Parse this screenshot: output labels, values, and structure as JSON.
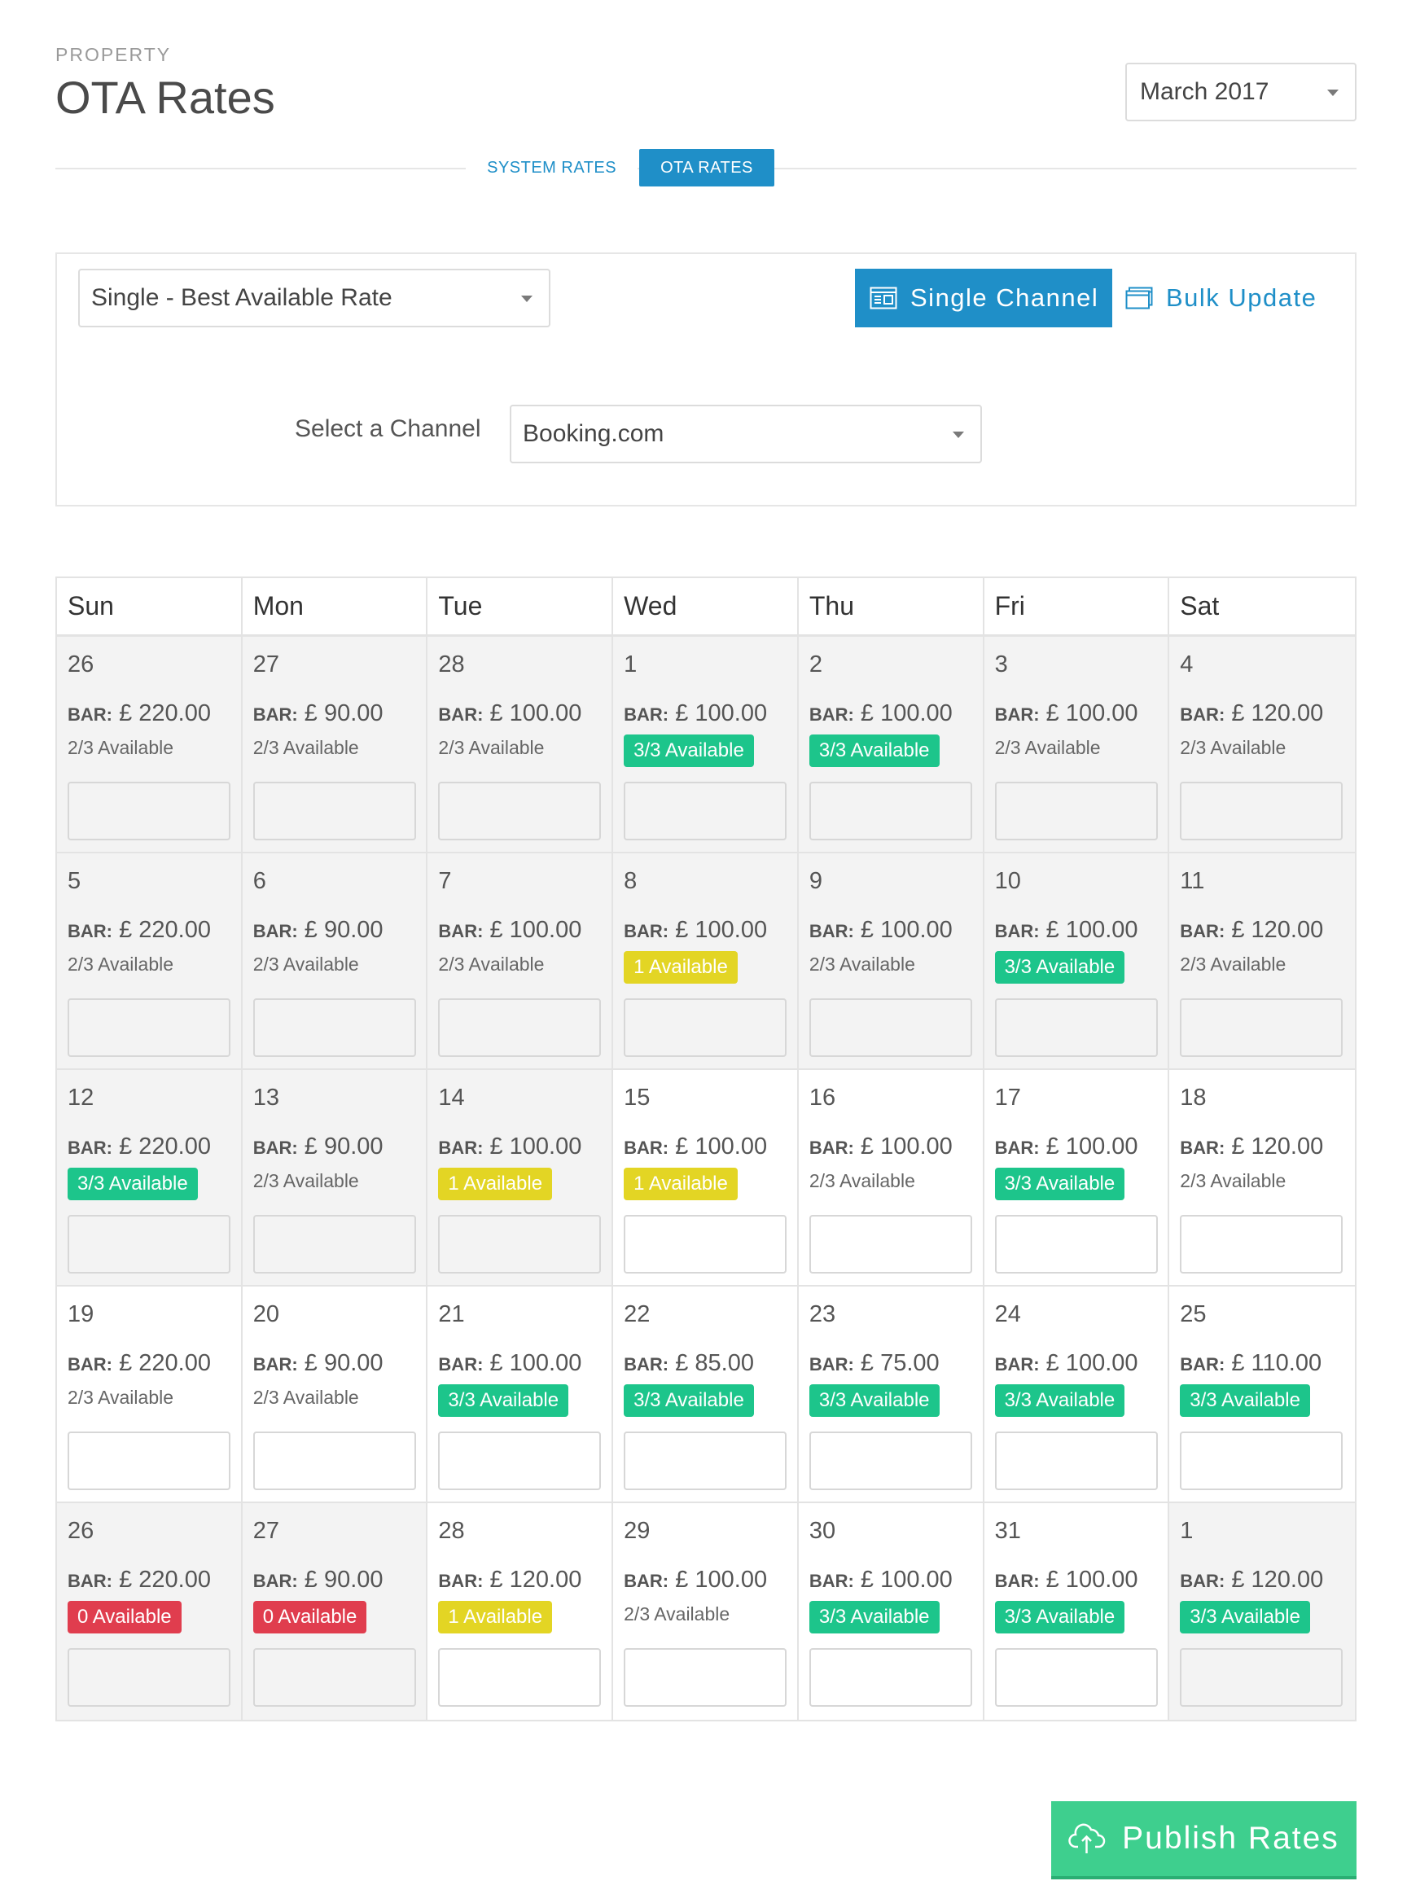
{
  "header": {
    "eyebrow": "PROPERTY",
    "title": "OTA Rates",
    "month": "March 2017"
  },
  "tabs": [
    {
      "label": "SYSTEM RATES",
      "active": false
    },
    {
      "label": "OTA RATES",
      "active": true
    }
  ],
  "filters": {
    "rate_plan": "Single - Best Available Rate",
    "single_channel_label": "Single Channel",
    "bulk_update_label": "Bulk Update",
    "channel_label": "Select a Channel",
    "channel_value": "Booking.com"
  },
  "calendar": {
    "bar_label": "BAR:",
    "weekdays": [
      "Sun",
      "Mon",
      "Tue",
      "Wed",
      "Thu",
      "Fri",
      "Sat"
    ],
    "weeks": [
      [
        {
          "day": "26",
          "rate": "£ 220.00",
          "avail": "2/3 Available",
          "status": "plain",
          "past": true
        },
        {
          "day": "27",
          "rate": "£ 90.00",
          "avail": "2/3 Available",
          "status": "plain",
          "past": true
        },
        {
          "day": "28",
          "rate": "£ 100.00",
          "avail": "2/3 Available",
          "status": "plain",
          "past": true
        },
        {
          "day": "1",
          "rate": "£ 100.00",
          "avail": "3/3 Available",
          "status": "green",
          "past": true
        },
        {
          "day": "2",
          "rate": "£ 100.00",
          "avail": "3/3 Available",
          "status": "green",
          "past": true
        },
        {
          "day": "3",
          "rate": "£ 100.00",
          "avail": "2/3 Available",
          "status": "plain",
          "past": true
        },
        {
          "day": "4",
          "rate": "£ 120.00",
          "avail": "2/3 Available",
          "status": "plain",
          "past": true
        }
      ],
      [
        {
          "day": "5",
          "rate": "£ 220.00",
          "avail": "2/3 Available",
          "status": "plain",
          "past": true
        },
        {
          "day": "6",
          "rate": "£ 90.00",
          "avail": "2/3 Available",
          "status": "plain",
          "past": true
        },
        {
          "day": "7",
          "rate": "£ 100.00",
          "avail": "2/3 Available",
          "status": "plain",
          "past": true
        },
        {
          "day": "8",
          "rate": "£ 100.00",
          "avail": "1 Available",
          "status": "yellow",
          "past": true
        },
        {
          "day": "9",
          "rate": "£ 100.00",
          "avail": "2/3 Available",
          "status": "plain",
          "past": true
        },
        {
          "day": "10",
          "rate": "£ 100.00",
          "avail": "3/3 Available",
          "status": "green",
          "past": true
        },
        {
          "day": "11",
          "rate": "£ 120.00",
          "avail": "2/3 Available",
          "status": "plain",
          "past": true
        }
      ],
      [
        {
          "day": "12",
          "rate": "£ 220.00",
          "avail": "3/3 Available",
          "status": "green",
          "past": true
        },
        {
          "day": "13",
          "rate": "£ 90.00",
          "avail": "2/3 Available",
          "status": "plain",
          "past": true
        },
        {
          "day": "14",
          "rate": "£ 100.00",
          "avail": "1 Available",
          "status": "yellow",
          "past": true
        },
        {
          "day": "15",
          "rate": "£ 100.00",
          "avail": "1 Available",
          "status": "yellow",
          "past": false
        },
        {
          "day": "16",
          "rate": "£ 100.00",
          "avail": "2/3 Available",
          "status": "plain",
          "past": false
        },
        {
          "day": "17",
          "rate": "£ 100.00",
          "avail": "3/3 Available",
          "status": "green",
          "past": false
        },
        {
          "day": "18",
          "rate": "£ 120.00",
          "avail": "2/3 Available",
          "status": "plain",
          "past": false
        }
      ],
      [
        {
          "day": "19",
          "rate": "£ 220.00",
          "avail": "2/3 Available",
          "status": "plain",
          "past": false
        },
        {
          "day": "20",
          "rate": "£ 90.00",
          "avail": "2/3 Available",
          "status": "plain",
          "past": false
        },
        {
          "day": "21",
          "rate": "£ 100.00",
          "avail": "3/3 Available",
          "status": "green",
          "past": false
        },
        {
          "day": "22",
          "rate": "£ 85.00",
          "avail": "3/3 Available",
          "status": "green",
          "past": false
        },
        {
          "day": "23",
          "rate": "£ 75.00",
          "avail": "3/3 Available",
          "status": "green",
          "past": false
        },
        {
          "day": "24",
          "rate": "£ 100.00",
          "avail": "3/3 Available",
          "status": "green",
          "past": false
        },
        {
          "day": "25",
          "rate": "£ 110.00",
          "avail": "3/3 Available",
          "status": "green",
          "past": false
        }
      ],
      [
        {
          "day": "26",
          "rate": "£ 220.00",
          "avail": "0 Available",
          "status": "red",
          "past": true
        },
        {
          "day": "27",
          "rate": "£ 90.00",
          "avail": "0 Available",
          "status": "red",
          "past": true
        },
        {
          "day": "28",
          "rate": "£ 120.00",
          "avail": "1 Available",
          "status": "yellow",
          "past": false
        },
        {
          "day": "29",
          "rate": "£ 100.00",
          "avail": "2/3 Available",
          "status": "plain",
          "past": false
        },
        {
          "day": "30",
          "rate": "£ 100.00",
          "avail": "3/3 Available",
          "status": "green",
          "past": false
        },
        {
          "day": "31",
          "rate": "£ 100.00",
          "avail": "3/3 Available",
          "status": "green",
          "past": false
        },
        {
          "day": "1",
          "rate": "£ 120.00",
          "avail": "3/3 Available",
          "status": "green",
          "past": true
        }
      ]
    ]
  },
  "publish_label": "Publish Rates",
  "colors": {
    "primary": "#1f8fc8",
    "green": "#1dc58b",
    "yellow": "#e3d524",
    "red": "#e03d4e",
    "publish": "#3ecf8e"
  }
}
